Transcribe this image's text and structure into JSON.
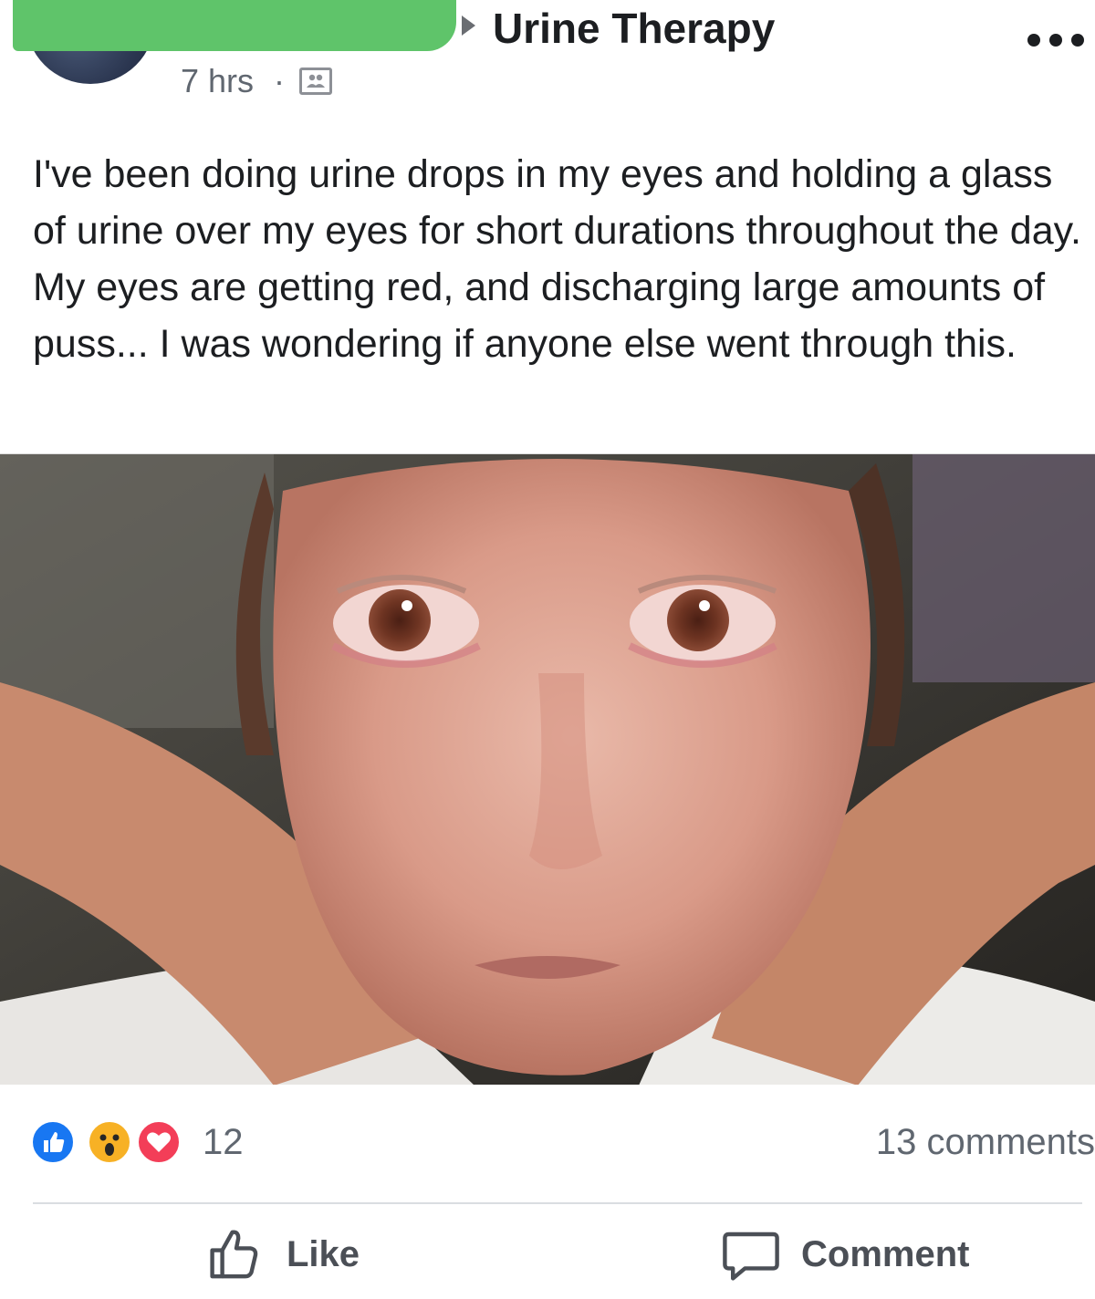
{
  "header": {
    "group_name": "Urine Therapy",
    "timestamp": "7 hrs",
    "separator": "·",
    "privacy_icon": "group-icon",
    "more_icon": "more-options-icon",
    "redaction_color": "#5fc46a"
  },
  "post": {
    "text": "I've been doing urine drops in my eyes and holding a glass of urine over my eyes for short durations throughout the day. My eyes are getting red, and discharging large amounts of puss... I was wondering if anyone else went through this."
  },
  "reactions": {
    "icons": [
      "like-icon",
      "wow-icon",
      "love-icon"
    ],
    "count": "12",
    "comments": "13 comments",
    "colors": {
      "like": "#1877f2",
      "wow": "#f7b125",
      "love": "#f33e58"
    }
  },
  "actions": {
    "like_label": "Like",
    "comment_label": "Comment"
  }
}
